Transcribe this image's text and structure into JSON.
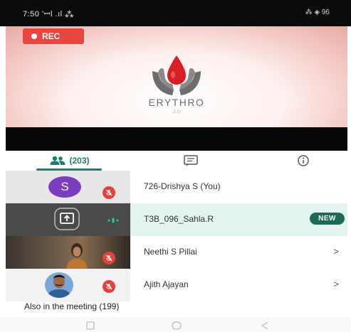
{
  "status_bar": {
    "time": "7:50",
    "left_indicators": "'ꟷl .ıl ⁂",
    "right_indicators": "⁂ ◈ 96"
  },
  "video": {
    "rec_label": "REC",
    "brand_name": "ERYTHRO",
    "brand_version": "2.0"
  },
  "tabs": {
    "participants_count": "(203)"
  },
  "participants": [
    {
      "name": "726-Drishya S (You)",
      "avatar_letter": "S",
      "muted": true,
      "arrow": ""
    },
    {
      "name": "T3B_096_Sahla.R",
      "badge": "NEW",
      "presenting": true,
      "arrow": ""
    },
    {
      "name": "Neethi S Pillai",
      "muted": true,
      "arrow": ">"
    },
    {
      "name": "Ajith Ajayan",
      "muted": true,
      "arrow": ">"
    }
  ],
  "also_in_meeting": "Also in the meeting (199)",
  "colors": {
    "accent": "#1e7c73",
    "rec_red": "#e8463f",
    "new_badge": "#1c6b55",
    "avatar_purple": "#7b3dbf",
    "highlight_row": "#e3f3f0"
  }
}
